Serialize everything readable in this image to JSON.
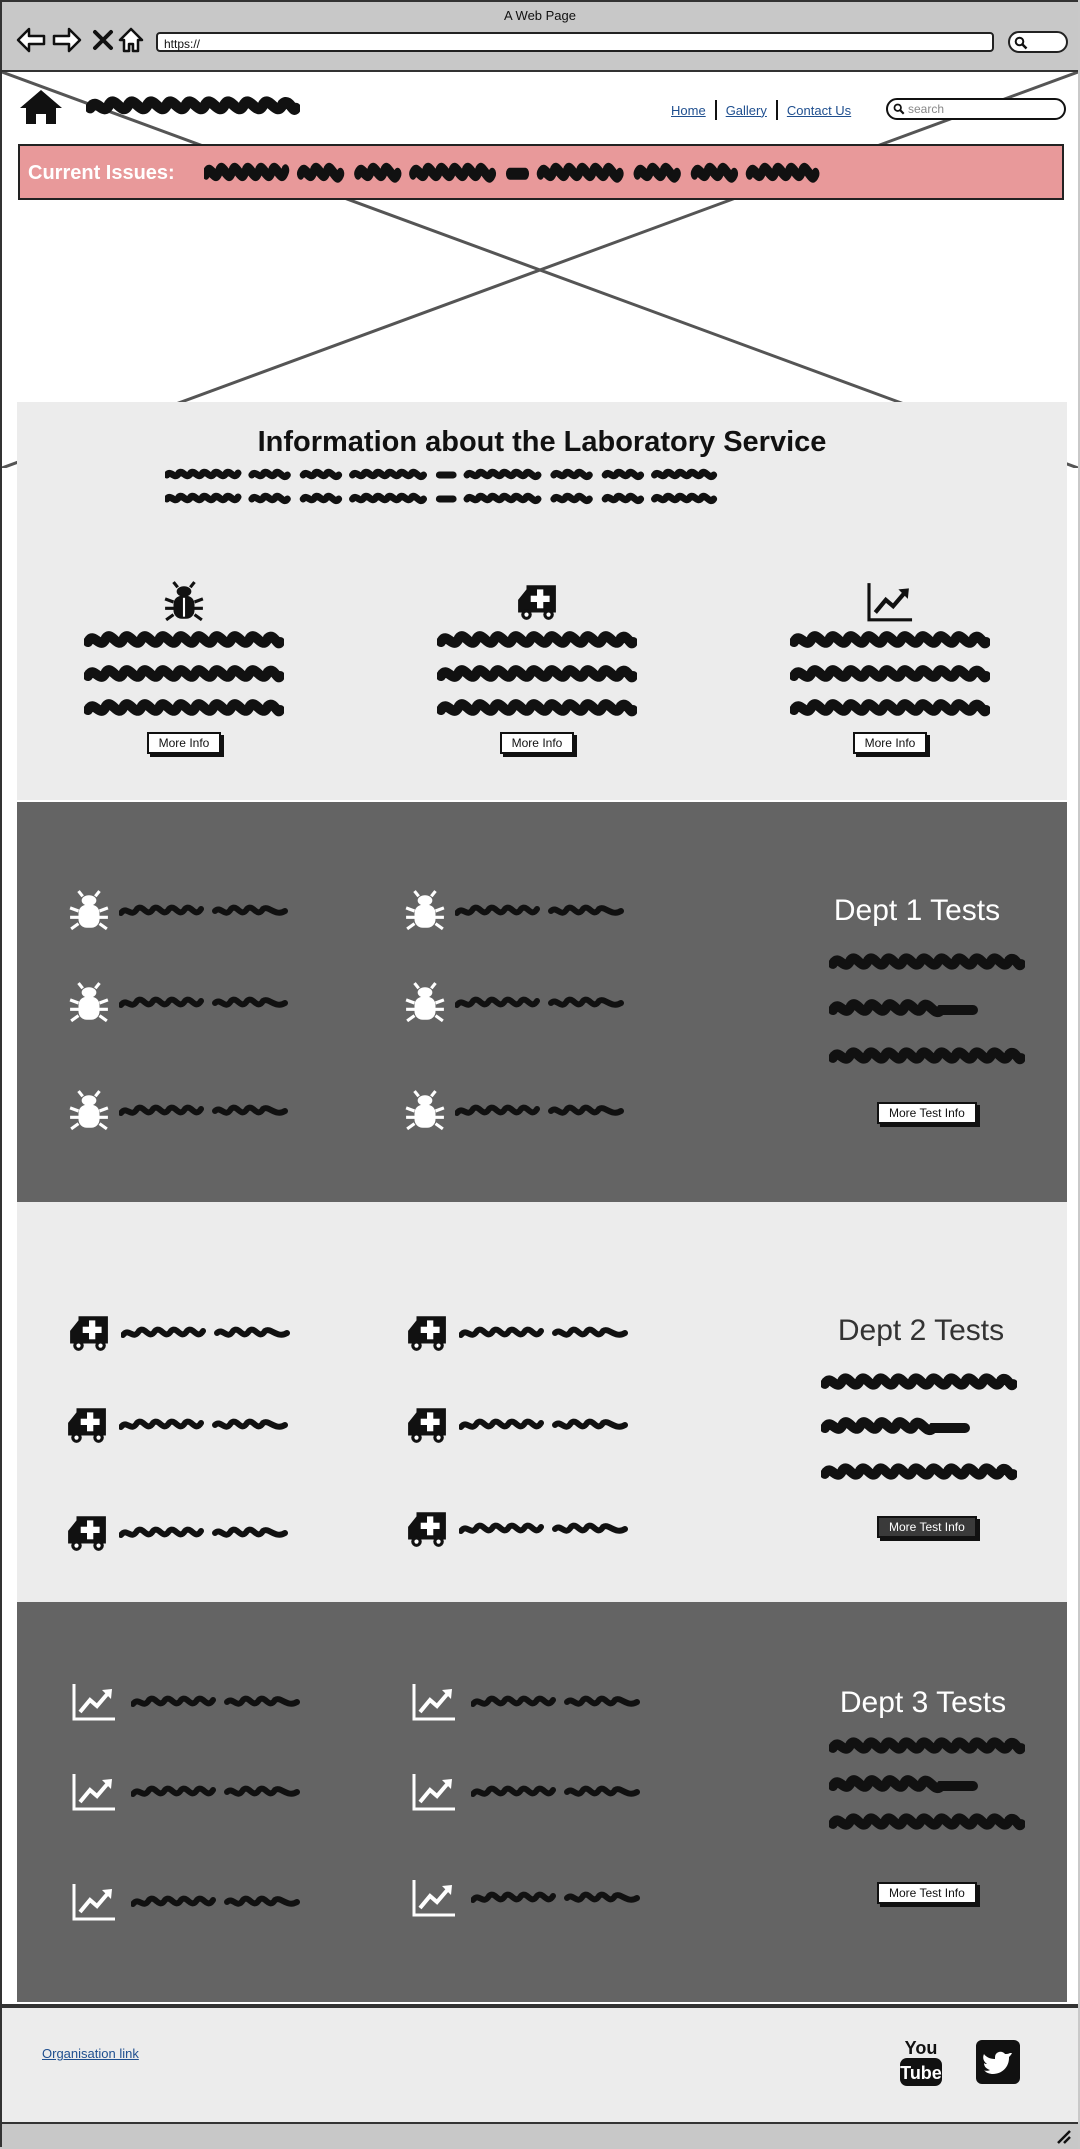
{
  "browser": {
    "window_title": "A Web Page",
    "url": "https://"
  },
  "header": {
    "nav": [
      {
        "label": "Home"
      },
      {
        "label": "Gallery"
      },
      {
        "label": "Contact Us"
      }
    ],
    "search_placeholder": "search"
  },
  "issues": {
    "label": "Current Issues:"
  },
  "info": {
    "title": "Information about the Laboratory Service",
    "columns": [
      {
        "icon": "bug-icon",
        "button": "More Info"
      },
      {
        "icon": "ambulance-icon",
        "button": "More Info"
      },
      {
        "icon": "line-chart-icon",
        "button": "More Info"
      }
    ]
  },
  "depts": [
    {
      "title": "Dept 1 Tests",
      "icon": "bug-icon",
      "button": "More Test Info"
    },
    {
      "title": "Dept 2 Tests",
      "icon": "ambulance-icon",
      "button": "More Test Info"
    },
    {
      "title": "Dept 3 Tests",
      "icon": "line-chart-icon",
      "button": "More Test Info"
    }
  ],
  "footer": {
    "org_link": "Organisation link",
    "social": [
      {
        "icon": "youtube-icon"
      },
      {
        "icon": "twitter-icon"
      }
    ]
  },
  "colors": {
    "issues_bg": "#e8999a",
    "dark_section": "#646464",
    "light_section": "#ececec",
    "link": "#1f4f8f"
  }
}
